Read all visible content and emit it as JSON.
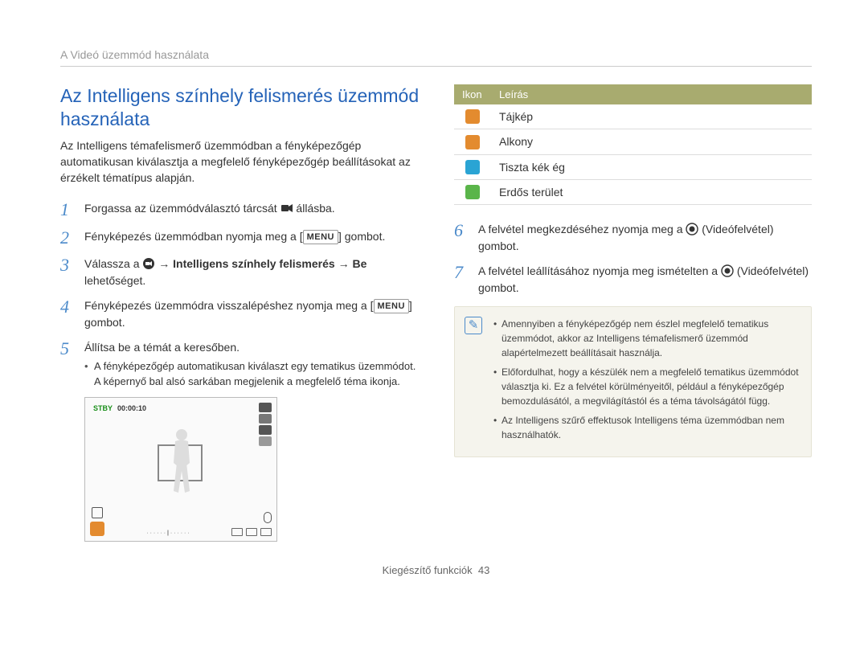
{
  "breadcrumb": "A Videó üzemmód használata",
  "heading": "Az Intelligens színhely felismerés üzemmód használata",
  "intro": "Az Intelligens témafelismerő üzemmódban a fényképezőgép automatikusan kiválasztja a megfelelő fényképezőgép beállításokat az érzékelt tématípus alapján.",
  "steps_left": [
    {
      "num": "1",
      "text_a": "Forgassa az üzemmódválasztó tárcsát ",
      "icon": "video-mode-icon",
      "text_b": " állásba."
    },
    {
      "num": "2",
      "text_a": "Fényképezés üzemmódban nyomja meg a ",
      "menu": "MENU",
      "text_b": " gombot."
    },
    {
      "num": "3",
      "text_a": "Válassza a ",
      "icon": "settings-mode-icon",
      "bold": " → Intelligens színhely felismerés → Be",
      "text_b": " lehetőséget."
    },
    {
      "num": "4",
      "text_a": "Fényképezés üzemmódra visszalépéshez nyomja meg a ",
      "menu": "MENU",
      "text_b": " gombot."
    },
    {
      "num": "5",
      "text_a": "Állítsa be a témát a keresőben.",
      "sub": [
        "A fényképezőgép automatikusan kiválaszt egy tematikus üzemmódot. A képernyő bal alsó sarkában megjelenik a megfelelő téma ikonja."
      ]
    }
  ],
  "preview": {
    "stby": "STBY",
    "counter": "00:00:10"
  },
  "icon_table": {
    "head_icon": "Ikon",
    "head_desc": "Leírás",
    "rows": [
      {
        "name": "landscape-icon",
        "color": "#e38b2f",
        "desc": "Tájkép"
      },
      {
        "name": "sunset-icon",
        "color": "#e38b2f",
        "desc": "Alkony"
      },
      {
        "name": "blue-sky-icon",
        "color": "#2aa4d4",
        "desc": "Tiszta kék ég"
      },
      {
        "name": "forest-icon",
        "color": "#5ab54a",
        "desc": "Erdős terület"
      }
    ]
  },
  "steps_right": [
    {
      "num": "6",
      "text_a": "A felvétel megkezdéséhez nyomja meg a ",
      "icon": "record-button-icon",
      "text_b": " (Videófelvétel) gombot."
    },
    {
      "num": "7",
      "text_a": "A felvétel leállításához nyomja meg ismételten a ",
      "icon": "record-button-icon",
      "text_b": " (Videófelvétel) gombot."
    }
  ],
  "notes": [
    "Amennyiben a fényképezőgép nem észlel megfelelő tematikus üzemmódot, akkor az Intelligens témafelismerő üzemmód alapértelmezett beállításait használja.",
    "Előfordulhat, hogy a készülék nem a megfelelő tematikus üzemmódot választja ki. Ez a felvétel körülményeitől, például a fényképezőgép bemozdulásától, a megvilágítástól és a téma távolságától függ.",
    "Az Intelligens szűrő effektusok Intelligens téma üzemmódban nem használhatók."
  ],
  "footer_label": "Kiegészítő funkciók",
  "footer_page": "43",
  "chart_data": null
}
